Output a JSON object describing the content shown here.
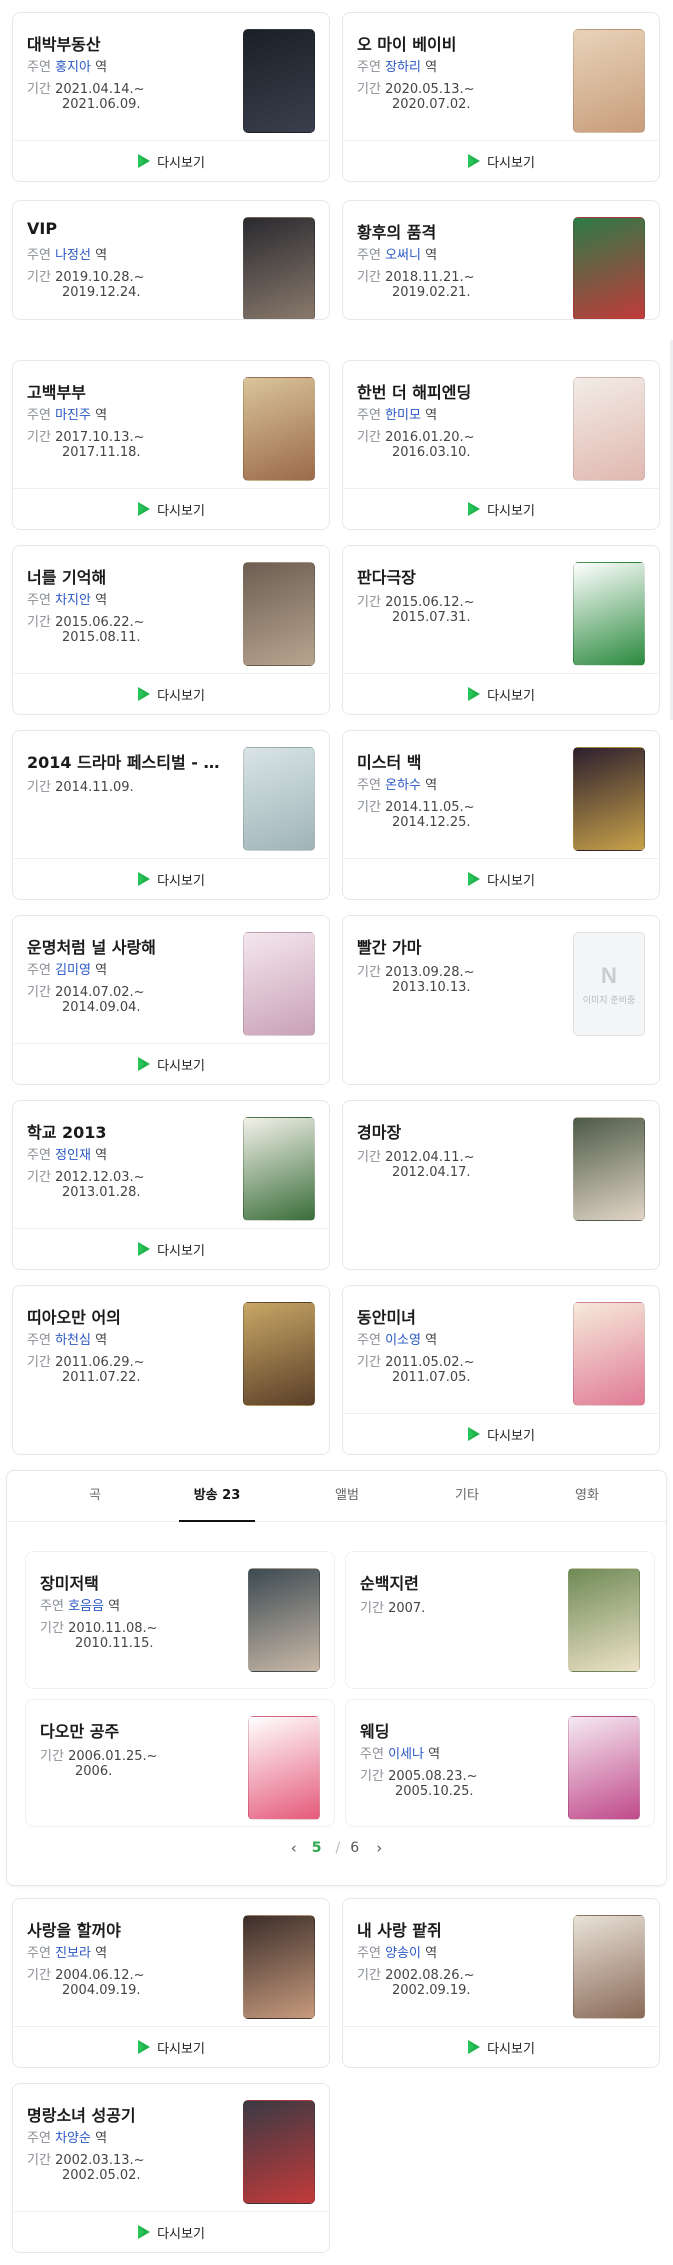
{
  "labels": {
    "cast": "주연",
    "period": "기간",
    "role_suffix": "역",
    "rewatch": "다시보기"
  },
  "cards_top": [
    {
      "title": "대박부동산",
      "cast": "홍지아",
      "period": [
        "2021.04.14.~",
        "2021.06.09."
      ],
      "rewatch": true,
      "poster_colors": [
        "#1b1f27",
        "#3a3f4d"
      ]
    },
    {
      "title": "오 마이 베이비",
      "cast": "장하리",
      "period": [
        "2020.05.13.~",
        "2020.07.02."
      ],
      "rewatch": true,
      "poster_colors": [
        "#e8d3b8",
        "#c89d7c"
      ]
    },
    {
      "title": "VIP",
      "cast": "나정선",
      "period": [
        "2019.10.28.~",
        "2019.12.24."
      ],
      "rewatch": false,
      "poster_colors": [
        "#2a2a30",
        "#8a7a6c"
      ]
    },
    {
      "title": "황후의 품격",
      "cast": "오써니",
      "period": [
        "2018.11.21.~",
        "2019.02.21."
      ],
      "rewatch": false,
      "poster_colors": [
        "#2d7a48",
        "#c23a3a"
      ]
    },
    {
      "title": "고백부부",
      "cast": "마진주",
      "period": [
        "2017.10.13.~",
        "2017.11.18."
      ],
      "rewatch": true,
      "poster_colors": [
        "#d9c49a",
        "#9b6a4a"
      ]
    },
    {
      "title": "한번 더 해피엔딩",
      "cast": "한미모",
      "period": [
        "2016.01.20.~",
        "2016.03.10."
      ],
      "rewatch": true,
      "poster_colors": [
        "#f2ece6",
        "#e0b8b0"
      ]
    },
    {
      "title": "너를 기억해",
      "cast": "차지안",
      "period": [
        "2015.06.22.~",
        "2015.08.11."
      ],
      "rewatch": true,
      "poster_colors": [
        "#6d5e52",
        "#b7a58f"
      ]
    },
    {
      "title": "판다극장",
      "cast": "",
      "period": [
        "2015.06.12.~",
        "2015.07.31."
      ],
      "rewatch": true,
      "poster_colors": [
        "#ffffff",
        "#2b8a3e"
      ]
    },
    {
      "title": "2014 드라마 페스티벌 - …",
      "cast": "",
      "period": [
        "2014.11.09."
      ],
      "rewatch": true,
      "poster_colors": [
        "#d9e4e6",
        "#9fb4b8"
      ]
    },
    {
      "title": "미스터 백",
      "cast": "온하수",
      "period": [
        "2014.11.05.~",
        "2014.12.25."
      ],
      "rewatch": true,
      "poster_colors": [
        "#2c1f2e",
        "#c8a24a"
      ]
    },
    {
      "title": "운명처럼 널 사랑해",
      "cast": "김미영",
      "period": [
        "2014.07.02.~",
        "2014.09.04."
      ],
      "rewatch": true,
      "poster_colors": [
        "#f4e7ee",
        "#c9a1b6"
      ]
    },
    {
      "title": "빨간 가마",
      "cast": "",
      "period": [
        "2013.09.28.~",
        "2013.10.13."
      ],
      "rewatch": false,
      "placeholder": {
        "letter": "N",
        "text": "이미지 준비중"
      }
    },
    {
      "title": "학교 2013",
      "cast": "정인재",
      "period": [
        "2012.12.03.~",
        "2013.01.28."
      ],
      "rewatch": true,
      "poster_colors": [
        "#f3f1ea",
        "#3a6e3a"
      ]
    },
    {
      "title": "경마장",
      "cast": "",
      "period": [
        "2012.04.11.~",
        "2012.04.17."
      ],
      "rewatch": false,
      "poster_colors": [
        "#4d5a48",
        "#e2d6c6"
      ]
    },
    {
      "title": "띠아오만 어의",
      "cast": "하천심",
      "period": [
        "2011.06.29.~",
        "2011.07.22."
      ],
      "rewatch": false,
      "poster_colors": [
        "#c9a766",
        "#5a3f28"
      ]
    },
    {
      "title": "동안미녀",
      "cast": "이소영",
      "period": [
        "2011.05.02.~",
        "2011.07.05."
      ],
      "rewatch": true,
      "poster_colors": [
        "#f6eadb",
        "#e07b96"
      ]
    }
  ],
  "tabs": [
    {
      "label": "곡",
      "active": false
    },
    {
      "label": "방송 23",
      "active": true
    },
    {
      "label": "앨범",
      "active": false
    },
    {
      "label": "기타",
      "active": false
    },
    {
      "label": "영화",
      "active": false
    }
  ],
  "tab_cards": [
    {
      "title": "장미저택",
      "cast": "호음음",
      "period": [
        "2010.11.08.~",
        "2010.11.15."
      ],
      "poster_colors": [
        "#3c4a52",
        "#c9b9a8"
      ]
    },
    {
      "title": "순백지련",
      "cast": "",
      "period": [
        "2007."
      ],
      "poster_colors": [
        "#6f8a56",
        "#ede3c7"
      ]
    },
    {
      "title": "다오만 공주",
      "cast": "",
      "period": [
        "2006.01.25.~",
        "2006."
      ],
      "poster_colors": [
        "#ffffff",
        "#e55a7a"
      ]
    },
    {
      "title": "웨딩",
      "cast": "이세나",
      "period": [
        "2005.08.23.~",
        "2005.10.25."
      ],
      "poster_colors": [
        "#f5e9f2",
        "#c04a8a"
      ]
    }
  ],
  "pagination": {
    "current": "5",
    "separator": "/",
    "total": "6"
  },
  "cards_bottom": [
    {
      "title": "사랑을 할꺼야",
      "cast": "진보라",
      "period": [
        "2004.06.12.~",
        "2004.09.19."
      ],
      "rewatch": true,
      "poster_colors": [
        "#3b2e2a",
        "#c79a7d"
      ]
    },
    {
      "title": "내 사랑 팥쥐",
      "cast": "양송이",
      "period": [
        "2002.08.26.~",
        "2002.09.19."
      ],
      "rewatch": true,
      "poster_colors": [
        "#e9e2d8",
        "#8a6a58"
      ]
    },
    {
      "title": "명랑소녀 성공기",
      "cast": "차양순",
      "period": [
        "2002.03.13.~",
        "2002.05.02."
      ],
      "rewatch": true,
      "poster_colors": [
        "#3a3a44",
        "#c33a3a"
      ]
    }
  ],
  "colors": {
    "accent_green": "#2fa84f",
    "link_blue": "#2b58c5",
    "play_green": "#1fb24a"
  }
}
